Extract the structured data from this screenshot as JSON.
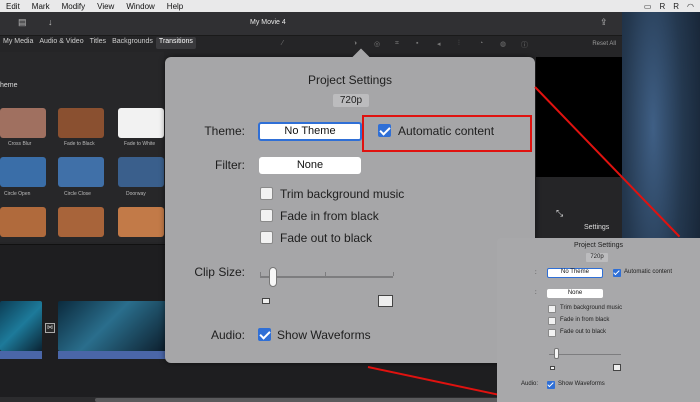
{
  "menubar": {
    "items": [
      "Edit",
      "Mark",
      "Modify",
      "View",
      "Window",
      "Help"
    ],
    "status_letters": [
      "R",
      "R"
    ]
  },
  "window": {
    "title": "My Movie 4"
  },
  "browser_tabs": [
    "My Media",
    "Audio & Video",
    "Titles",
    "Backgrounds",
    "Transitions"
  ],
  "browser": {
    "section_label": "heme",
    "thumbnails": [
      {
        "label": "Cross Blur",
        "color": "#a07060"
      },
      {
        "label": "Fade to Black",
        "color": "#8a5030"
      },
      {
        "label": "Fade to White",
        "color": "#f2f2f2"
      },
      {
        "label": "Circle Open",
        "color": "#3a6ea8"
      },
      {
        "label": "Circle Close",
        "color": "#4070a8"
      },
      {
        "label": "Doorway",
        "color": "#3a5f8c"
      },
      {
        "label": "",
        "color": "#b06a3c"
      },
      {
        "label": "",
        "color": "#a8643a"
      },
      {
        "label": "",
        "color": "#c27a48"
      }
    ]
  },
  "adjust_bar": {
    "reset_label": "Reset All"
  },
  "viewer": {
    "settings_label": "Settings"
  },
  "project_settings": {
    "title": "Project Settings",
    "resolution": "720p",
    "theme_label": "Theme:",
    "theme_value": "No Theme",
    "automatic_content_label": "Automatic content",
    "automatic_content_checked": true,
    "filter_label": "Filter:",
    "filter_value": "None",
    "options": [
      {
        "label": "Trim background music",
        "checked": false
      },
      {
        "label": "Fade in from black",
        "checked": false
      },
      {
        "label": "Fade out to black",
        "checked": false
      }
    ],
    "clip_size_label": "Clip Size:",
    "clip_size_level": 0.1,
    "audio_label": "Audio:",
    "show_waveforms_label": "Show Waveforms",
    "show_waveforms_checked": true
  },
  "colors": {
    "accent": "#2f6fd6",
    "highlight": "#e0120f",
    "popover_bg": "#a6a6a8"
  }
}
